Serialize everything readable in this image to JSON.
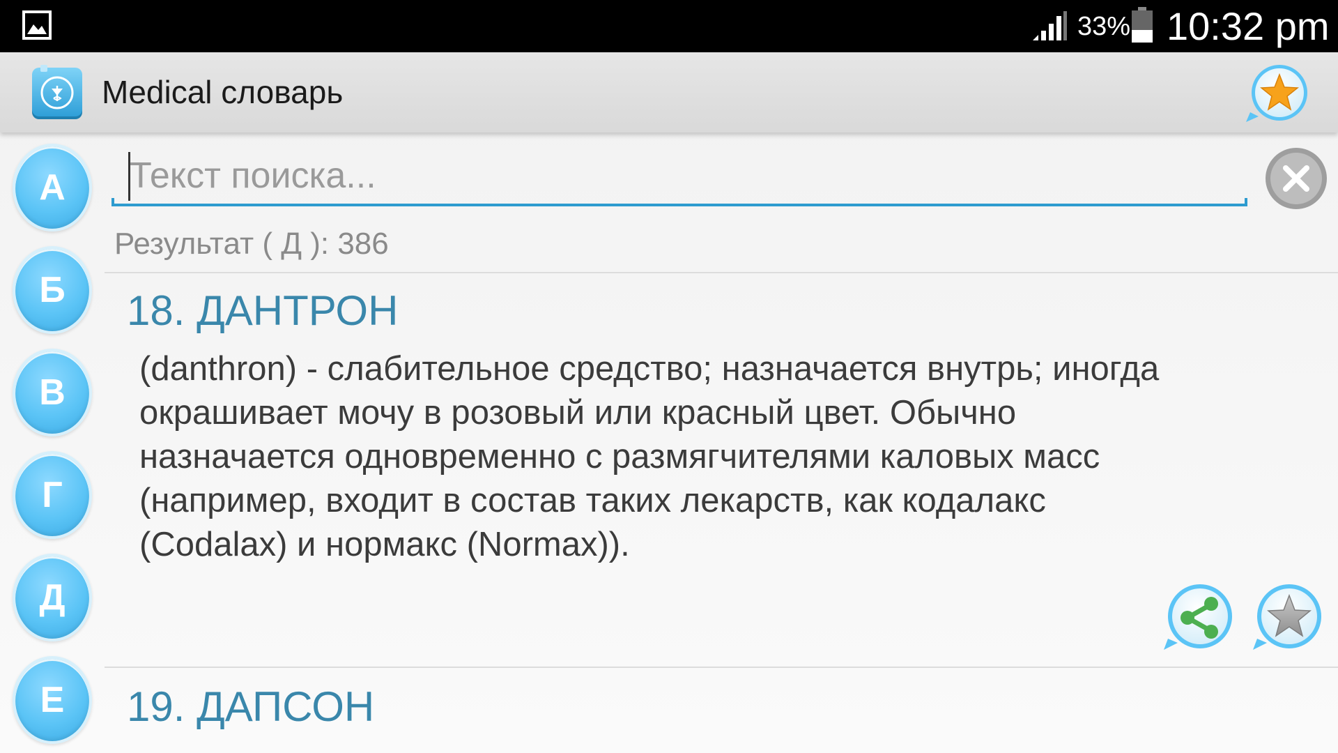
{
  "status_bar": {
    "battery_percent": "33%",
    "time": "10:32 pm"
  },
  "action_bar": {
    "title": "Medical словарь"
  },
  "alphabet": [
    "А",
    "Б",
    "В",
    "Г",
    "Д",
    "Е"
  ],
  "search": {
    "placeholder": "Текст поиска...",
    "value": ""
  },
  "result_count": "Результат ( Д ): 386",
  "entries": [
    {
      "title": "18. ДАНТРОН",
      "lines": [
        "(danthron) - слабительное средство; назначается внутрь; иногда",
        "окрашивает мочу в розовый или красный цвет. Обычно",
        "назначается одновременно с размягчителями каловых масс",
        "(например, входит в состав таких лекарств, как кодалакс",
        "(Codalax) и нормакс (Normax))."
      ]
    },
    {
      "title": "19. ДАПСОН"
    }
  ],
  "colors": {
    "accent": "#2e9bcf",
    "letter_button": "#5bc4f6",
    "entry_title": "#3a87ab",
    "share_green": "#4caf50",
    "star_orange": "#f7a21b"
  },
  "icons": {
    "status_left": "gallery-icon",
    "signal": "signal-icon",
    "battery": "battery-icon",
    "logo": "pharmacy-logo-icon",
    "favorites": "star-icon",
    "clear": "close-icon",
    "share": "share-icon",
    "favorite_entry": "star-outline-icon"
  }
}
